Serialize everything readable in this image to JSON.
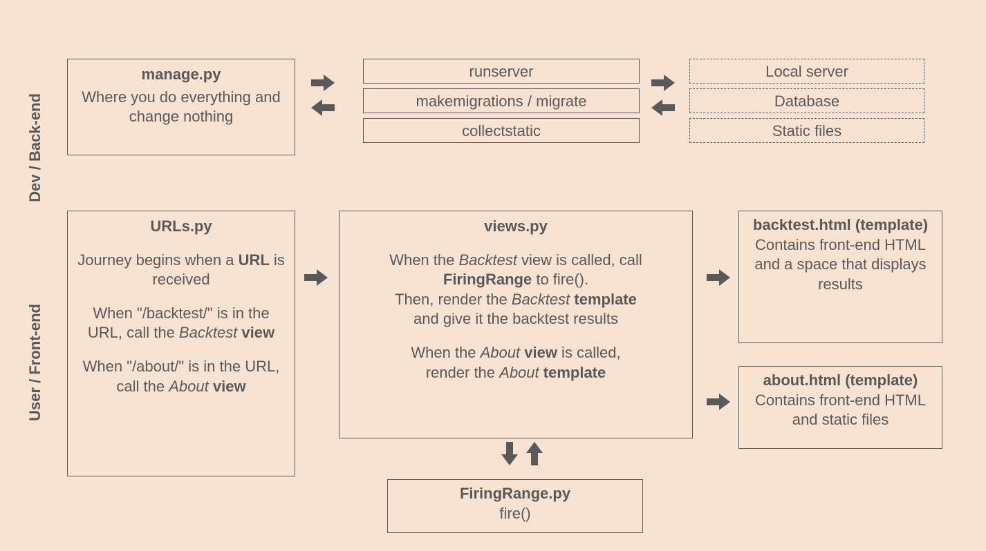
{
  "labels": {
    "dev": "Dev / Back-end",
    "user": "User / Front-end"
  },
  "manage": {
    "title": "manage.py",
    "body": "Where you do everything and change nothing"
  },
  "commands": {
    "runserver": "runserver",
    "migrate": "makemigrations / migrate",
    "collectstatic": "collectstatic"
  },
  "outputs": {
    "local": "Local server",
    "database": "Database",
    "static": "Static files"
  },
  "urls": {
    "title": "URLs.py",
    "p1a": "Journey begins when a ",
    "p1b": "URL",
    "p1c": " is received",
    "p2a": "When \"/backtest/\" is in the URL, call the ",
    "p2b": "Backtest",
    "p2c": " ",
    "p2d": "view",
    "p3a": "When \"/about/\" is in the URL, call the ",
    "p3b": "About",
    "p3c": " ",
    "p3d": "view"
  },
  "views": {
    "title": "views.py",
    "l1a": "When the ",
    "l1b": "Backtest",
    "l1c": " view is called, call ",
    "l2a": "FiringRange",
    "l2b": " to fire().",
    "l3a": "Then, render the ",
    "l3b": "Backtest",
    "l3c": " ",
    "l3d": "template",
    "l4": "and give it the backtest results",
    "l5a": "When the ",
    "l5b": "About",
    "l5c": " ",
    "l5d": "view",
    "l5e": " is called,",
    "l6a": "render the ",
    "l6b": "About",
    "l6c": " ",
    "l6d": "template"
  },
  "backtest": {
    "title": "backtest.html (template)",
    "body": "Contains front-end HTML and a space that displays results"
  },
  "about": {
    "title": "about.html (template)",
    "body": "Contains front-end HTML and static files"
  },
  "firing": {
    "title": "FiringRange.py",
    "body": "fire()"
  }
}
